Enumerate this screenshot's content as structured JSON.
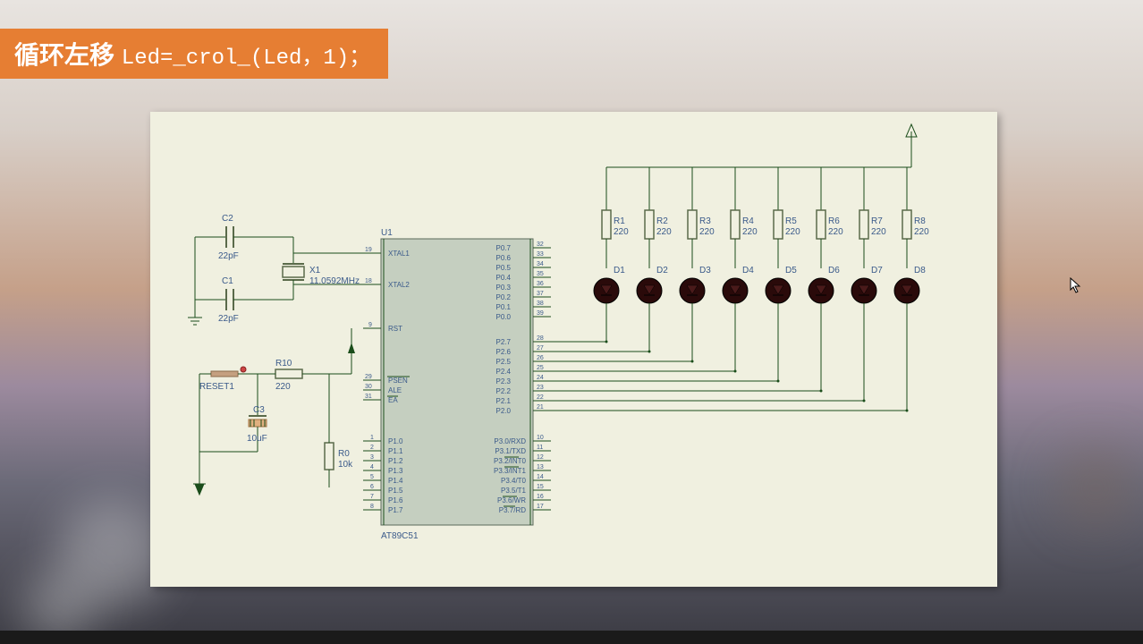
{
  "title": {
    "chinese": "循环左移",
    "code": "Led=_crol_(Led，1)；"
  },
  "chip": {
    "ref": "U1",
    "part": "AT89C51",
    "pins_left": [
      {
        "num": "19",
        "name": "XTAL1"
      },
      {
        "num": "18",
        "name": "XTAL2"
      },
      {
        "num": "9",
        "name": "RST"
      },
      {
        "num": "29",
        "name": "PSEN"
      },
      {
        "num": "30",
        "name": "ALE"
      },
      {
        "num": "31",
        "name": "EA"
      },
      {
        "num": "1",
        "name": "P1.0"
      },
      {
        "num": "2",
        "name": "P1.1"
      },
      {
        "num": "3",
        "name": "P1.2"
      },
      {
        "num": "4",
        "name": "P1.3"
      },
      {
        "num": "5",
        "name": "P1.4"
      },
      {
        "num": "6",
        "name": "P1.5"
      },
      {
        "num": "7",
        "name": "P1.6"
      },
      {
        "num": "8",
        "name": "P1.7"
      }
    ],
    "pins_right_top": [
      {
        "num": "32",
        "name": "P0.7"
      },
      {
        "num": "33",
        "name": "P0.6"
      },
      {
        "num": "34",
        "name": "P0.5"
      },
      {
        "num": "35",
        "name": "P0.4"
      },
      {
        "num": "36",
        "name": "P0.3"
      },
      {
        "num": "37",
        "name": "P0.2"
      },
      {
        "num": "38",
        "name": "P0.1"
      },
      {
        "num": "39",
        "name": "P0.0"
      }
    ],
    "pins_right_mid": [
      {
        "num": "28",
        "name": "P2.7"
      },
      {
        "num": "27",
        "name": "P2.6"
      },
      {
        "num": "26",
        "name": "P2.5"
      },
      {
        "num": "25",
        "name": "P2.4"
      },
      {
        "num": "24",
        "name": "P2.3"
      },
      {
        "num": "23",
        "name": "P2.2"
      },
      {
        "num": "22",
        "name": "P2.1"
      },
      {
        "num": "21",
        "name": "P2.0"
      }
    ],
    "pins_right_bot": [
      {
        "num": "10",
        "name": "P3.0/RXD"
      },
      {
        "num": "11",
        "name": "P3.1/TXD"
      },
      {
        "num": "12",
        "name": "P3.2/INT0"
      },
      {
        "num": "13",
        "name": "P3.3/INT1"
      },
      {
        "num": "14",
        "name": "P3.4/T0"
      },
      {
        "num": "15",
        "name": "P3.5/T1"
      },
      {
        "num": "16",
        "name": "P3.6/WR"
      },
      {
        "num": "17",
        "name": "P3.7/RD"
      }
    ]
  },
  "components": {
    "c1": {
      "ref": "C1",
      "val": "22pF"
    },
    "c2": {
      "ref": "C2",
      "val": "22pF"
    },
    "c3": {
      "ref": "C3",
      "val": "10uF"
    },
    "x1": {
      "ref": "X1",
      "val": "11.0592MHz"
    },
    "r0": {
      "ref": "R0",
      "val": "10k"
    },
    "r10": {
      "ref": "R10",
      "val": "220"
    },
    "reset": {
      "ref": "RESET1"
    }
  },
  "led_array": {
    "resistors": [
      {
        "ref": "R1",
        "val": "220"
      },
      {
        "ref": "R2",
        "val": "220"
      },
      {
        "ref": "R3",
        "val": "220"
      },
      {
        "ref": "R4",
        "val": "220"
      },
      {
        "ref": "R5",
        "val": "220"
      },
      {
        "ref": "R6",
        "val": "220"
      },
      {
        "ref": "R7",
        "val": "220"
      },
      {
        "ref": "R8",
        "val": "220"
      }
    ],
    "leds": [
      "D1",
      "D2",
      "D3",
      "D4",
      "D5",
      "D6",
      "D7",
      "D8"
    ]
  }
}
